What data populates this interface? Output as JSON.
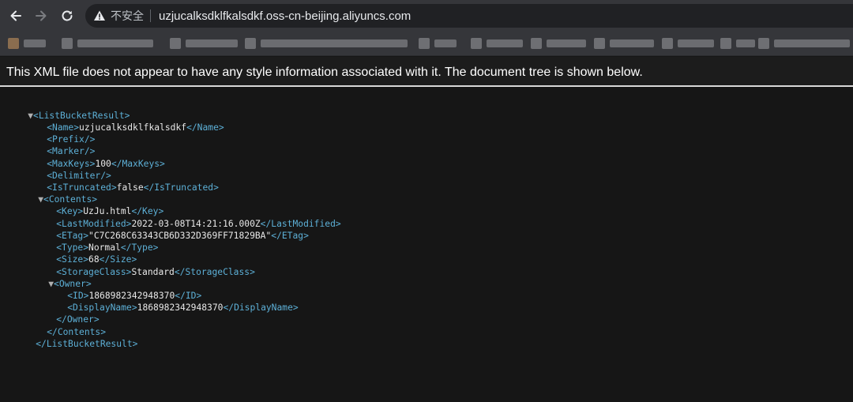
{
  "browser": {
    "nav": {
      "back_icon": "arrow-left-icon",
      "forward_icon": "arrow-right-icon",
      "reload_icon": "reload-icon"
    },
    "omnibox": {
      "security_icon": "warning-triangle-icon",
      "security_label": "不安全",
      "url": "uzjucalksdklfkalsdkf.oss-cn-beijing.aliyuncs.com"
    }
  },
  "banner": {
    "text": "This XML file does not appear to have any style information associated with it. The document tree is shown below."
  },
  "xml": {
    "root_open": "<ListBucketResult>",
    "name_open": "<Name>",
    "name_value": "uzjucalksdklfkalsdkf",
    "name_close": "</Name>",
    "prefix": "<Prefix/>",
    "marker": "<Marker/>",
    "maxkeys_open": "<MaxKeys>",
    "maxkeys_value": "100",
    "maxkeys_close": "</MaxKeys>",
    "delimiter": "<Delimiter/>",
    "istruncated_open": "<IsTruncated>",
    "istruncated_value": "false",
    "istruncated_close": "</IsTruncated>",
    "contents_open": "<Contents>",
    "key_open": "<Key>",
    "key_value": "UzJu.html",
    "key_close": "</Key>",
    "lastmodified_open": "<LastModified>",
    "lastmodified_value": "2022-03-08T14:21:16.000Z",
    "lastmodified_close": "</LastModified>",
    "etag_open": "<ETag>",
    "etag_value": "\"C7C268C63343CB6D332D369FF71829BA\"",
    "etag_close": "</ETag>",
    "type_open": "<Type>",
    "type_value": "Normal",
    "type_close": "</Type>",
    "size_open": "<Size>",
    "size_value": "68",
    "size_close": "</Size>",
    "storageclass_open": "<StorageClass>",
    "storageclass_value": "Standard",
    "storageclass_close": "</StorageClass>",
    "owner_open": "<Owner>",
    "id_open": "<ID>",
    "id_value": "1868982342948370",
    "id_close": "</ID>",
    "displayname_open": "<DisplayName>",
    "displayname_value": "1868982342948370",
    "displayname_close": "</DisplayName>",
    "owner_close": "</Owner>",
    "contents_close": "</Contents>",
    "root_close": "</ListBucketResult>",
    "toggle_glyph": "▼"
  },
  "colors": {
    "tag": "#5db0d7",
    "text": "#e8e8e8",
    "background": "#161616"
  }
}
